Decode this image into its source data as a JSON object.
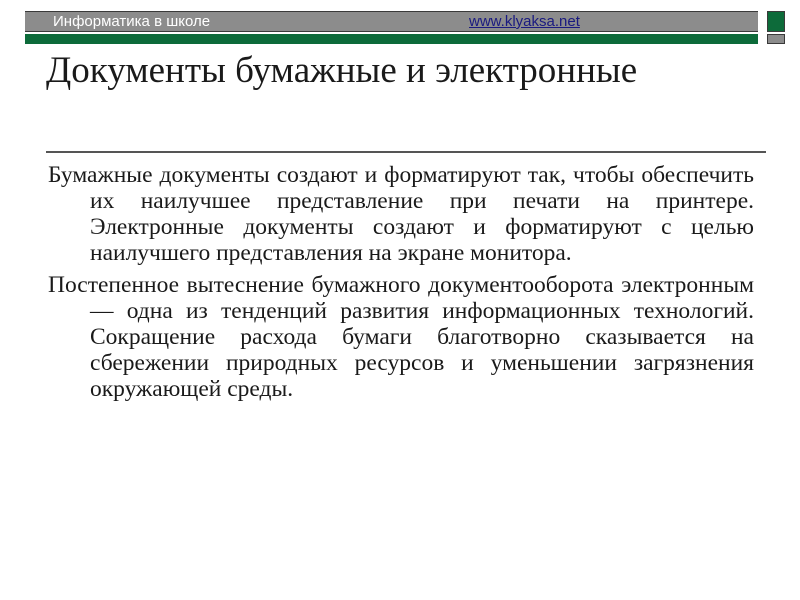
{
  "header": {
    "site_name": "Информатика в школе",
    "link_text": "www.klyaksa.net"
  },
  "colors": {
    "header_gray": "#8c8c8c",
    "accent_green": "#0d6b3a",
    "link_blue": "#1a1a80"
  },
  "slide": {
    "title": "Документы бумажные и электронные",
    "paragraphs": [
      "Бумажные документы создают и форматируют так, чтобы обеспечить их наилучшее представление при печати на принтере. Электронные документы создают и форматируют с целью наилучшего представления на экране монитора.",
      "Постепенное вытеснение бумажного документооборота электронным — одна из тенденций развития информационных технологий. Сокращение расхода бумаги благотворно сказывается на сбережении природных ресурсов и уменьшении загрязнения окружающей среды."
    ]
  }
}
